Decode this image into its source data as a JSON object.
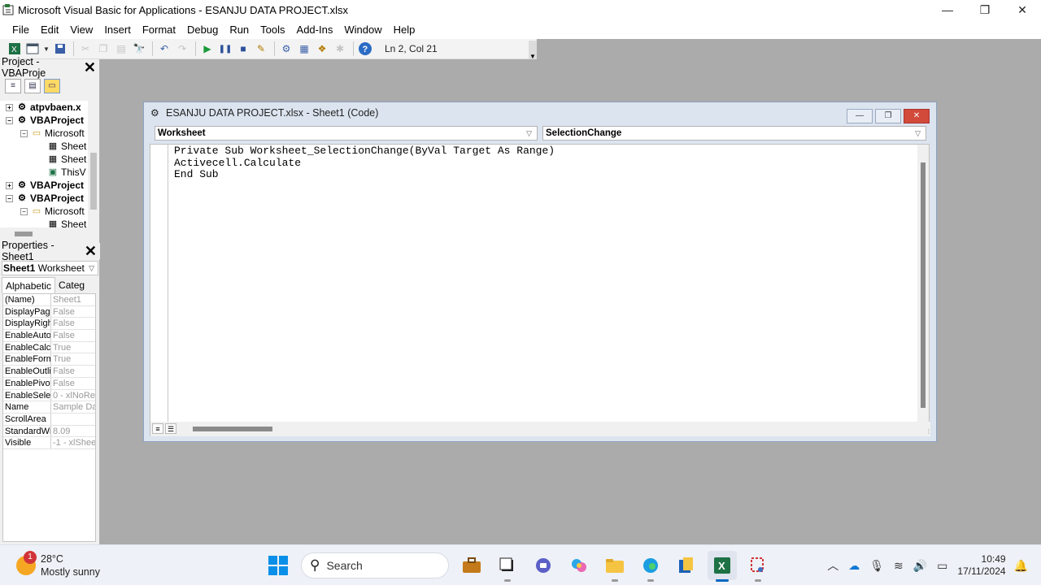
{
  "window": {
    "title": "Microsoft Visual Basic for Applications - ESANJU DATA PROJECT.xlsx",
    "controls": [
      "—",
      "❐",
      "✕"
    ]
  },
  "menu": [
    "File",
    "Edit",
    "View",
    "Insert",
    "Format",
    "Debug",
    "Run",
    "Tools",
    "Add-Ins",
    "Window",
    "Help"
  ],
  "toolbar": {
    "position": "Ln 2, Col 21"
  },
  "project": {
    "title": "Project - VBAProje",
    "tree": [
      {
        "label": "atpvbaen.x",
        "bold": true,
        "exp": "+",
        "icon": "vba-project-icon"
      },
      {
        "label": "VBAProject",
        "bold": true,
        "exp": "−",
        "icon": "vba-project-icon"
      },
      {
        "label": "Microsoft",
        "bold": false,
        "exp": "−",
        "icon": "folder-icon"
      },
      {
        "label": "Sheet",
        "bold": false,
        "exp": "",
        "icon": "sheet-icon"
      },
      {
        "label": "Sheet",
        "bold": false,
        "exp": "",
        "icon": "sheet-icon"
      },
      {
        "label": "ThisV",
        "bold": false,
        "exp": "",
        "icon": "workbook-icon"
      },
      {
        "label": "VBAProject",
        "bold": true,
        "exp": "+",
        "icon": "vba-project-icon"
      },
      {
        "label": "VBAProject",
        "bold": true,
        "exp": "−",
        "icon": "vba-project-icon"
      },
      {
        "label": "Microsoft",
        "bold": false,
        "exp": "−",
        "icon": "folder-icon"
      },
      {
        "label": "Sheet",
        "bold": false,
        "exp": "",
        "icon": "sheet-icon"
      }
    ]
  },
  "properties": {
    "title": "Properties - Sheet1",
    "object_name": "Sheet1",
    "object_type": "Worksheet",
    "tabs": [
      "Alphabetic",
      "Categ"
    ],
    "rows": [
      {
        "k": "(Name)",
        "v": "Sheet1"
      },
      {
        "k": "DisplayPage",
        "v": "False"
      },
      {
        "k": "DisplayRigh",
        "v": "False"
      },
      {
        "k": "EnableAutoF",
        "v": "False"
      },
      {
        "k": "EnableCalcu",
        "v": "True"
      },
      {
        "k": "EnableForm",
        "v": "True"
      },
      {
        "k": "EnableOutlir",
        "v": "False"
      },
      {
        "k": "EnablePivot",
        "v": "False"
      },
      {
        "k": "EnableSelect",
        "v": "0 - xlNoRe"
      },
      {
        "k": "Name",
        "v": "Sample Da"
      },
      {
        "k": "ScrollArea",
        "v": ""
      },
      {
        "k": "StandardWic",
        "v": "8.09"
      },
      {
        "k": "Visible",
        "v": "-1 - xlShee"
      }
    ]
  },
  "code_window": {
    "title": "ESANJU DATA PROJECT.xlsx - Sheet1 (Code)",
    "object_dropdown": "Worksheet",
    "procedure_dropdown": "SelectionChange",
    "code": "Private Sub Worksheet_SelectionChange(ByVal Target As Range)\nActivecell.Calculate\nEnd Sub"
  },
  "taskbar": {
    "weather_temp": "28°C",
    "weather_desc": "Mostly sunny",
    "weather_badge": "1",
    "search_placeholder": "Search",
    "time": "10:49",
    "date": "17/11/2024"
  }
}
